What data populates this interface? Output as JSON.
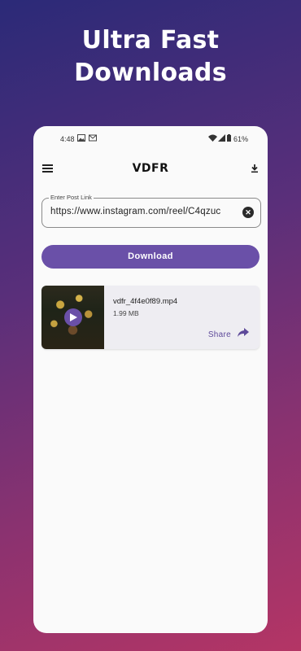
{
  "headline": {
    "line1": "Ultra Fast",
    "line2": "Downloads"
  },
  "statusbar": {
    "time": "4:48",
    "battery": "61%"
  },
  "appbar": {
    "title": "VDFR"
  },
  "input": {
    "label": "Enter Post Link",
    "value": "https://www.instagram.com/reel/C4qzuc"
  },
  "download_button": {
    "label": "Download"
  },
  "download_item": {
    "file_name": "vdfr_4f4e0f89.mp4",
    "file_size": "1.99 MB",
    "share_label": "Share"
  },
  "colors": {
    "accent": "#6a50a8",
    "background": "#fafafa"
  }
}
